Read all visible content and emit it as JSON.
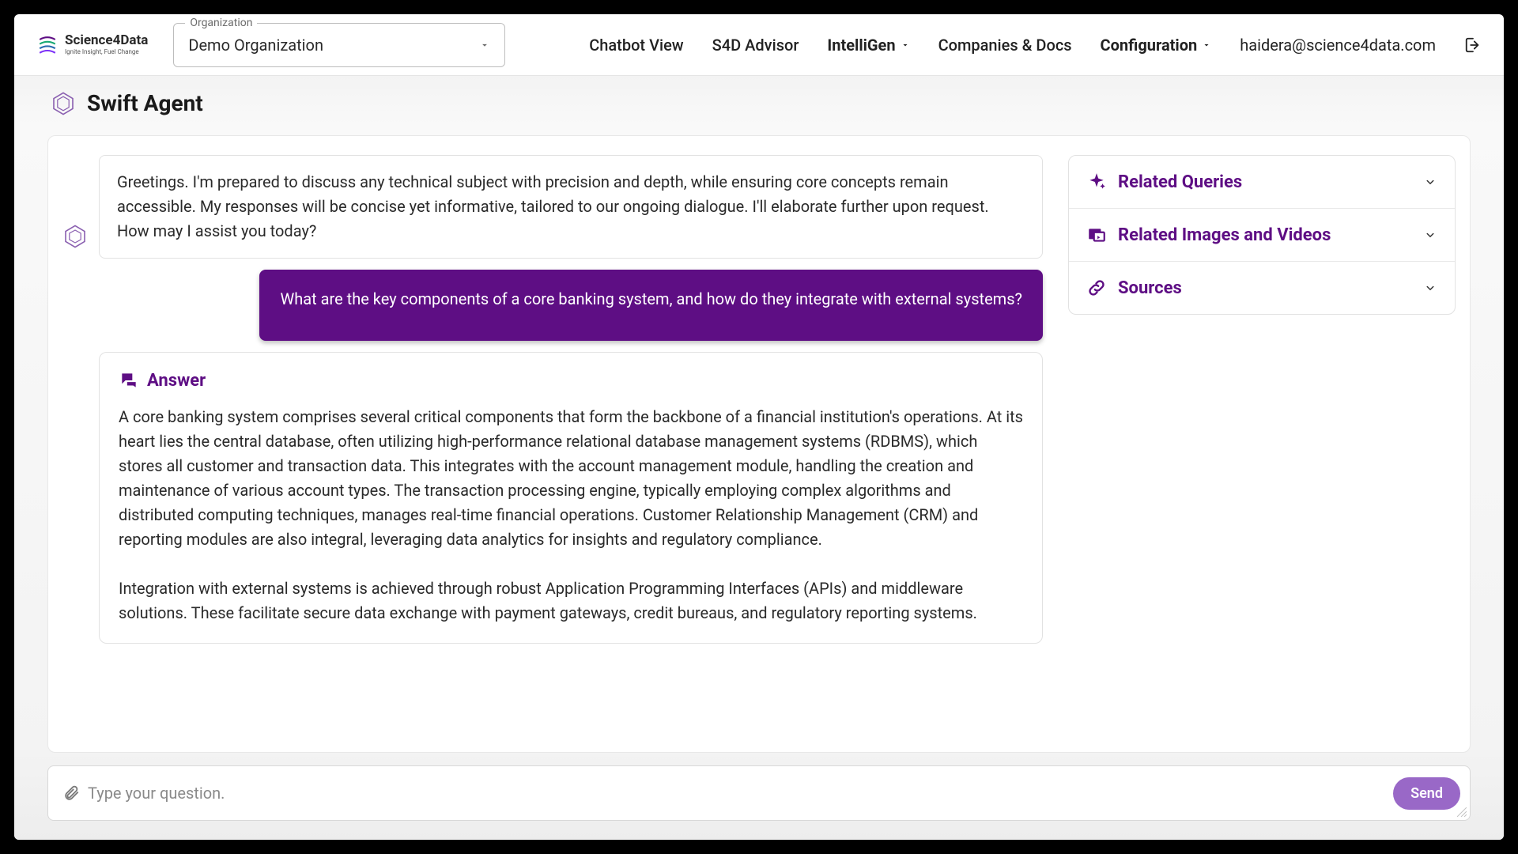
{
  "brand": {
    "name": "Science4Data",
    "tagline": "Ignite Insight, Fuel Change"
  },
  "org_select": {
    "legend": "Organization",
    "value": "Demo Organization"
  },
  "nav": {
    "chatbot": "Chatbot View",
    "advisor": "S4D Advisor",
    "intelligen": "IntelliGen",
    "companies": "Companies & Docs",
    "configuration": "Configuration"
  },
  "user": {
    "email": "haidera@science4data.com"
  },
  "page_title": "Swift Agent",
  "chat": {
    "greeting": "Greetings. I'm prepared to discuss any technical subject with precision and depth, while ensuring core concepts remain accessible. My responses will be concise yet informative, tailored to our ongoing dialogue. I'll elaborate further upon request. How may I assist you today?",
    "user_question": "What are the key components of a core banking system, and how do they integrate with external systems?",
    "answer_label": "Answer",
    "answer_body": "A core banking system comprises several critical components that form the backbone of a financial institution's operations. At its heart lies the central database, often utilizing high-performance relational database management systems (RDBMS), which stores all customer and transaction data. This integrates with the account management module, handling the creation and maintenance of various account types. The transaction processing engine, typically employing complex algorithms and distributed computing techniques, manages real-time financial operations. Customer Relationship Management (CRM) and reporting modules are also integral, leveraging data analytics for insights and regulatory compliance.\n\nIntegration with external systems is achieved through robust Application Programming Interfaces (APIs) and middleware solutions. These facilitate secure data exchange with payment gateways, credit bureaus, and regulatory reporting systems."
  },
  "side": {
    "related_queries": "Related Queries",
    "related_media": "Related Images and Videos",
    "sources": "Sources"
  },
  "input": {
    "placeholder": "Type your question.",
    "send": "Send"
  },
  "colors": {
    "accent": "#5e0e84"
  }
}
